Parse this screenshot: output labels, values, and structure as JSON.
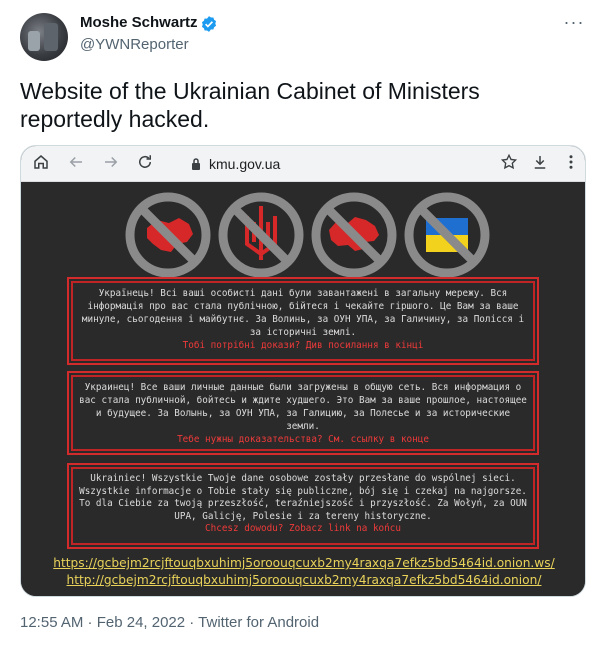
{
  "author": {
    "name": "Moshe Schwartz",
    "handle": "@YWNReporter",
    "verified_icon": "verified-badge-icon",
    "accent": "#1d9bf0"
  },
  "more_icon": "more-horizontal-icon",
  "tweet_text": "Website of the Ukrainian Cabinet of Ministers reportedly hacked.",
  "browser": {
    "url": "kmu.gov.ua",
    "icons": [
      "home-icon",
      "back-icon",
      "forward-icon",
      "reload-icon",
      "lock-icon",
      "star-icon",
      "download-icon",
      "menu-icon"
    ]
  },
  "site": {
    "symbols": [
      "crossed-out-ukraine-map-icon",
      "crossed-out-trident-icon",
      "crossed-out-map-icon",
      "crossed-out-flag-icon"
    ],
    "messages": [
      {
        "text": "Українець! Всі ваші особисті дані були завантажені в загальну мережу. Вся інформація про вас стала публічною, бійтеся і чекайте гіршого. Це Вам за ваше минуле, сьогодення і майбутнє. За Волинь, за ОУН УПА, за Галичину, за Полісся і за історичні землі.",
        "highlight": "Тобі потрібні докази? Див посилання в кінці"
      },
      {
        "text": "Украинец! Все ваши личные данные были загружены в общую сеть. Вся информация о вас стала публичной, бойтесь и ждите худшего. Это Вам за ваше прошлое, настоящее и будущее. За Волынь, за ОУН УПА, за Галицию, за Полесье и за исторические земли.",
        "highlight": "Тебе нужны доказательства? См. ссылку в конце"
      },
      {
        "text": "Ukrainiec! Wszystkie Twoje dane osobowe zostały przesłane do wspólnej sieci. Wszystkie informacje o Tobie stały się publiczne, bój się i czekaj na najgorsze. To dla Ciebie za twoją przeszłość, teraźniejszość i przyszłość. Za Wołyń, za OUN UPA, Galicję, Polesie i za tereny historyczne.",
        "highlight": "Chcesz dowodu? Zobacz link na końcu"
      }
    ],
    "links": [
      "https://gcbejm2rcjftouqbxuhimj5oroouqcuxb2my4raxqa7efkz5bd5464id.onion.ws/",
      "http://gcbejm2rcjftouqbxuhimj5oroouqcuxb2my4raxqa7efkz5bd5464id.onion/"
    ]
  },
  "footer": "12:55 AM · Feb 24, 2022 · Twitter for Android"
}
